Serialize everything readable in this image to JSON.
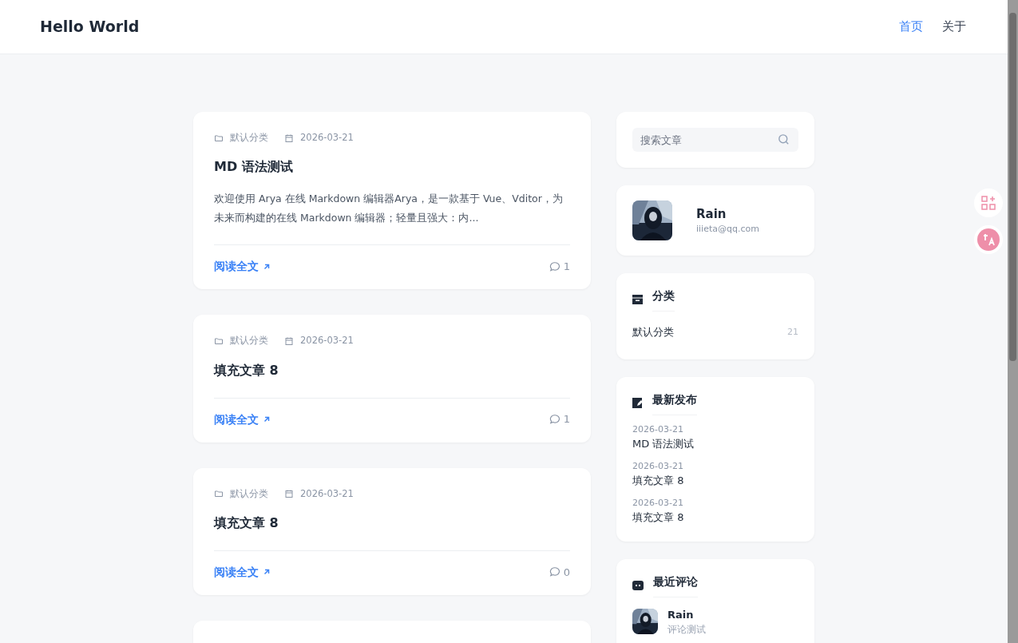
{
  "header": {
    "site_title": "Hello World",
    "nav": [
      {
        "label": "首页",
        "selected": true
      },
      {
        "label": "关于",
        "selected": false
      }
    ]
  },
  "posts": [
    {
      "category": "默认分类",
      "date": "2026-03-21",
      "title": "MD 语法测试",
      "excerpt": "欢迎使用 Arya 在线 Markdown 编辑器Arya，是一款基于 Vue、Vditor，为未来而构建的在线 Markdown 编辑器；轻量且强大：内...",
      "read_more": "阅读全文",
      "comments": "1"
    },
    {
      "category": "默认分类",
      "date": "2026-03-21",
      "title": "填充文章 8",
      "read_more": "阅读全文",
      "comments": "1"
    },
    {
      "category": "默认分类",
      "date": "2026-03-21",
      "title": "填充文章 8",
      "read_more": "阅读全文",
      "comments": "0"
    }
  ],
  "sidebar": {
    "search": {
      "placeholder": "搜索文章"
    },
    "profile": {
      "name": "Rain",
      "email": "iiieta@qq.com"
    },
    "categories": {
      "title": "分类",
      "items": [
        {
          "name": "默认分类",
          "count": "21"
        }
      ]
    },
    "latest": {
      "title": "最新发布",
      "items": [
        {
          "date": "2026-03-21",
          "title": "MD 语法测试"
        },
        {
          "date": "2026-03-21",
          "title": "填充文章 8"
        },
        {
          "date": "2026-03-21",
          "title": "填充文章 8"
        }
      ]
    },
    "comments": {
      "title": "最近评论",
      "items": [
        {
          "author": "Rain",
          "text": "评论测试"
        }
      ]
    }
  }
}
